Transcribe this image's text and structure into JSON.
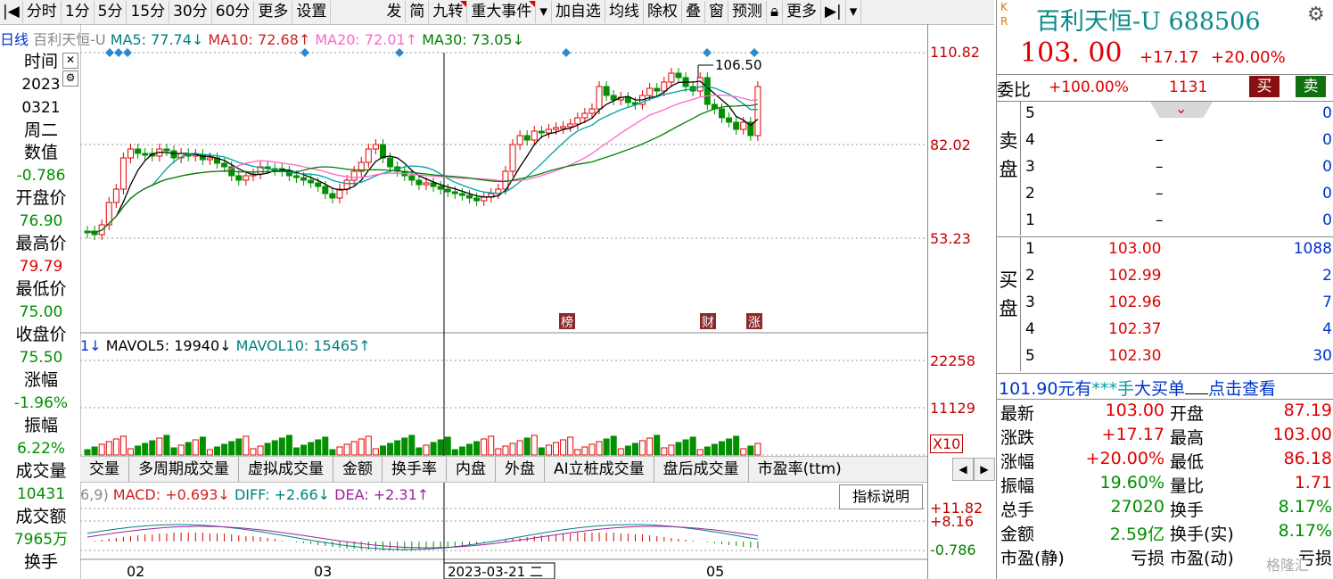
{
  "toolbar": {
    "items": [
      "分时",
      "1分",
      "5分",
      "15分",
      "30分",
      "60分",
      "更多",
      "设置",
      "发",
      "简",
      "九转",
      "重大事件",
      "加自选",
      "均线",
      "除权",
      "叠",
      "窗",
      "预测",
      "更多"
    ]
  },
  "ma_line": {
    "period": "日线",
    "name": "百利天恒-U",
    "ma5": "MA5: 77.74↓",
    "ma10": "MA10: 72.68↑",
    "ma20": "MA20: 72.01↑",
    "ma30": "MA30: 73.05↓"
  },
  "info_panel": {
    "time_label": "时间",
    "year": "2023",
    "date": "0321",
    "weekday": "周二",
    "value_label": "数值",
    "value": "-0.786",
    "open_label": "开盘价",
    "open": "76.90",
    "high_label": "最高价",
    "high": "79.79",
    "low_label": "最低价",
    "low": "75.00",
    "close_label": "收盘价",
    "close": "75.50",
    "change_label": "涨幅",
    "change": "-1.96%",
    "amp_label": "振幅",
    "amp": "6.22%",
    "vol_label": "成交量",
    "vol": "10431",
    "amount_label": "成交额",
    "amount": "7965万",
    "turnover_label": "换手"
  },
  "price_axis": {
    "p1": "110.82",
    "p2": "82.02",
    "p3": "53.23"
  },
  "peak_label": "106.50",
  "event_markers": [
    "榜",
    "财",
    "涨"
  ],
  "volume": {
    "label1": "1↓",
    "mavol5": "MAVOL5: 19940↓",
    "mavol10": "MAVOL10: 15465↑",
    "v1": "22258",
    "v2": "11129",
    "unit": "X10"
  },
  "tabs": [
    "交量",
    "多周期成交量",
    "虚拟成交量",
    "金额",
    "换手率",
    "内盘",
    "外盘",
    "AI立桩成交量",
    "盘后成交量",
    "市盈率(ttm)"
  ],
  "macd": {
    "params": "6,9)",
    "macd": "MACD: +0.693↓",
    "diff": "DIFF: +2.66↓",
    "dea": "DEA: +2.31↑",
    "a1": "+11.82",
    "a2": "+8.16",
    "a3": "-0.786",
    "help": "指标说明"
  },
  "xaxis": {
    "m1": "02",
    "m2": "03",
    "cursor": "2023-03-21 二",
    "m3": "05"
  },
  "stock": {
    "name": "百利天恒-U 688506",
    "price": "103. 00",
    "chg": "+17.17",
    "pct": "+20.00%",
    "kr_k": "K",
    "kr_r": "R"
  },
  "weibi": {
    "label": "委比",
    "value": "+100.00%",
    "diff": "1131",
    "buy": "买",
    "sell": "卖"
  },
  "sell_label": [
    "卖",
    "盘"
  ],
  "buy_label": [
    "买",
    "盘"
  ],
  "asks": [
    {
      "lvl": "5",
      "price": "",
      "vol": "0"
    },
    {
      "lvl": "4",
      "price": "–",
      "vol": "0"
    },
    {
      "lvl": "3",
      "price": "–",
      "vol": "0"
    },
    {
      "lvl": "2",
      "price": "–",
      "vol": "0"
    },
    {
      "lvl": "1",
      "price": "–",
      "vol": "0"
    }
  ],
  "bids": [
    {
      "lvl": "1",
      "price": "103.00",
      "vol": "1088"
    },
    {
      "lvl": "2",
      "price": "102.99",
      "vol": "2"
    },
    {
      "lvl": "3",
      "price": "102.96",
      "vol": "7"
    },
    {
      "lvl": "4",
      "price": "102.37",
      "vol": "4"
    },
    {
      "lvl": "5",
      "price": "102.30",
      "vol": "30"
    }
  ],
  "bigbuy": {
    "amount": "101.90元有",
    "stars": "***手",
    "label": "大买单",
    "click": "点击查看"
  },
  "stats": [
    {
      "l": "最新",
      "v": "103.00",
      "l2": "开盘",
      "v2": "87.19"
    },
    {
      "l": "涨跌",
      "v": "+17.17",
      "l2": "最高",
      "v2": "103.00"
    },
    {
      "l": "涨幅",
      "v": "+20.00%",
      "l2": "最低",
      "v2": "86.18"
    },
    {
      "l": "振幅",
      "v": "19.60%",
      "l2": "量比",
      "v2": "1.71"
    },
    {
      "l": "总手",
      "v": "27020",
      "l2": "换手",
      "v2": "8.17%"
    },
    {
      "l": "金额",
      "v": "2.59亿",
      "l2": "换手(实)",
      "v2": "8.17%"
    },
    {
      "l": "市盈(静)",
      "v": "亏损",
      "l2": "市盈(动)",
      "v2": "亏损"
    }
  ],
  "watermark": "格隆汇",
  "colors": {
    "up": "#e00000",
    "down": "#009000",
    "ma5": "#000000",
    "ma10": "#00a0a0",
    "ma20": "#ff66cc",
    "ma30": "#008000"
  }
}
